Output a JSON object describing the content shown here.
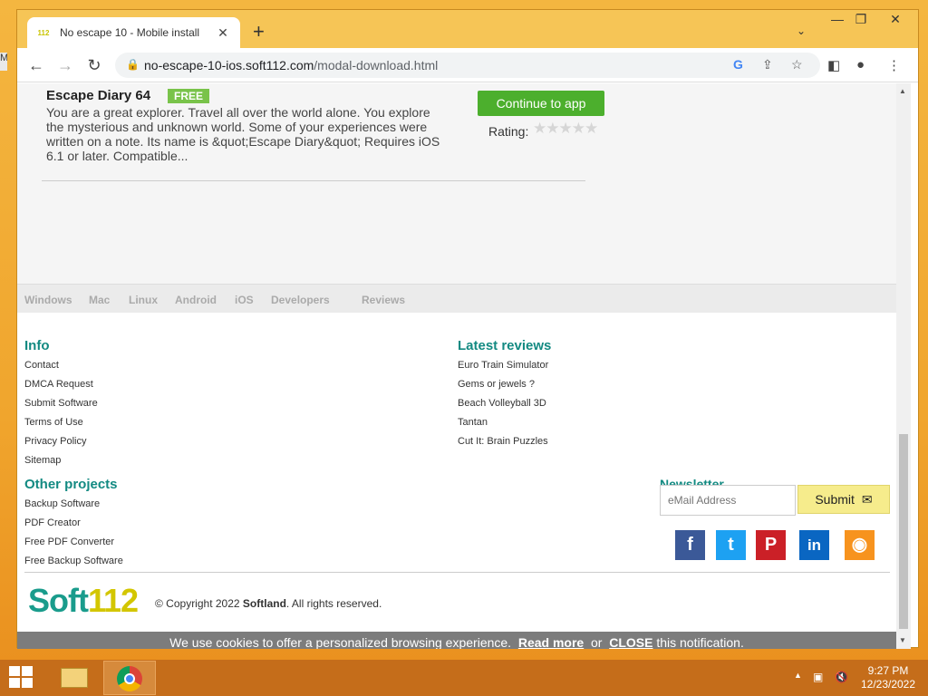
{
  "browser": {
    "tab_title": "No escape 10 - Mobile install",
    "favicon_text": "112",
    "url_main": "no-escape-10-ios.soft112.com",
    "url_path": "/modal-download.html"
  },
  "app": {
    "title": "Escape Diary 64",
    "badge": "FREE",
    "description": "You are a great explorer. Travel all over the world alone. You explore the mysterious and unknown world. Some of your experiences were written on a note. Its name is &quot;Escape Diary&quot; Requires iOS 6.1 or later. Compatible...",
    "continue_label": "Continue to app",
    "rating_label": "Rating:",
    "stars": "★★★★★",
    "rating_value": 0
  },
  "platforms": [
    "Windows",
    "Mac",
    "Linux",
    "Android",
    "iOS",
    "Developers",
    "Reviews"
  ],
  "footer": {
    "info_heading": "Info",
    "info_links": [
      "Contact",
      "DMCA Request",
      "Submit Software",
      "Terms of Use",
      "Privacy Policy",
      "Sitemap"
    ],
    "reviews_heading": "Latest reviews",
    "review_links": [
      "Euro Train Simulator",
      "Gems or jewels ?",
      "Beach Volleyball 3D",
      "Tantan",
      "Cut It: Brain Puzzles"
    ],
    "projects_heading": "Other projects",
    "project_links": [
      "Backup Software",
      "PDF Creator",
      "Free PDF Converter",
      "Free Backup Software"
    ],
    "newsletter_heading": "Newsletter",
    "email_placeholder": "eMail Address",
    "submit_label": "Submit",
    "logo_soft": "Soft",
    "logo_num": "112",
    "copyright_prefix": "© Copyright 2022",
    "copyright_company": "Softland",
    "copyright_suffix": ". All rights reserved."
  },
  "social": {
    "facebook": {
      "glyph": "f",
      "color": "#3b5998"
    },
    "twitter": {
      "glyph": "t",
      "color": "#1da1f2"
    },
    "pinterest": {
      "glyph": "P",
      "color": "#cb2027"
    },
    "linkedin": {
      "glyph": "in",
      "color": "#0a66c2"
    },
    "rss": {
      "glyph": "◉",
      "color": "#f7931e"
    }
  },
  "cookie": {
    "text": "We use cookies to offer a personalized browsing experience.",
    "read_more": "Read more",
    "or": "or",
    "close": "CLOSE",
    "tail": "this notification."
  },
  "taskbar": {
    "time": "9:27 PM",
    "date": "12/23/2022"
  },
  "colors": {
    "accent_teal": "#138a82",
    "button_green": "#4caf2d",
    "badge_green": "#79c34a"
  }
}
